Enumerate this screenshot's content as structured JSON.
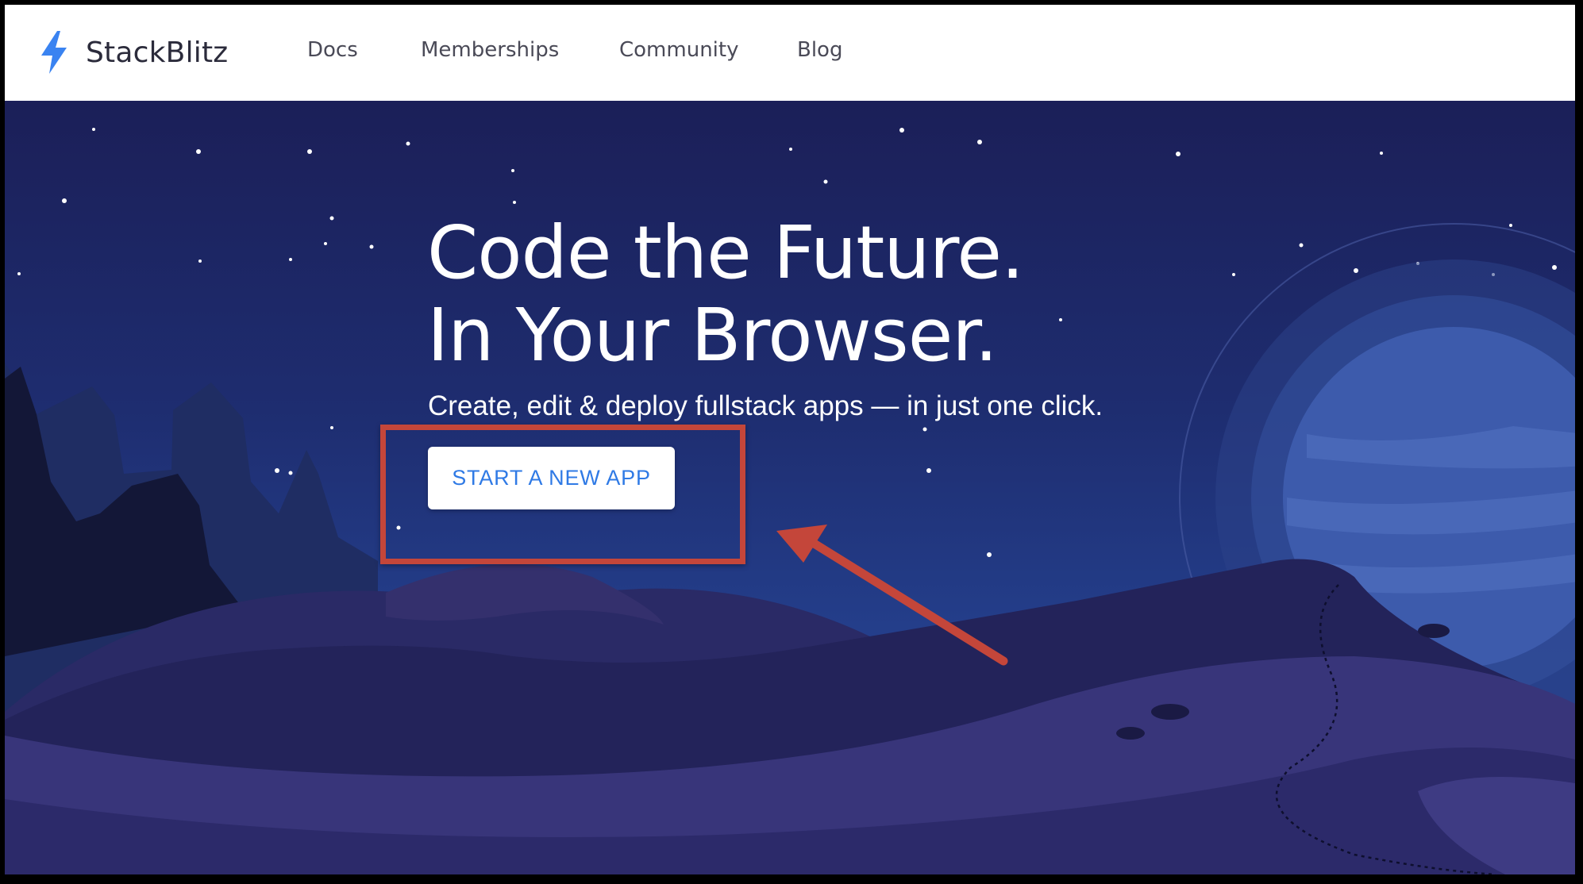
{
  "navbar": {
    "brand": "StackBlitz",
    "links": [
      "Docs",
      "Memberships",
      "Community",
      "Blog"
    ]
  },
  "hero": {
    "headline_line1": "Code the Future.",
    "headline_line2": "In Your Browser.",
    "subheadline": "Create, edit & deploy fullstack apps — in just one click.",
    "cta_label": "START A NEW APP"
  },
  "colors": {
    "brand_blue": "#3a83f1",
    "cta_text": "#2f7ae5",
    "annotation_red": "#c4463a",
    "hero_navy": "#1b1f58"
  },
  "icons": [
    "lightning-bolt-icon"
  ],
  "annotation": {
    "type": "highlight-box-with-arrow",
    "target": "start-new-app-button"
  }
}
